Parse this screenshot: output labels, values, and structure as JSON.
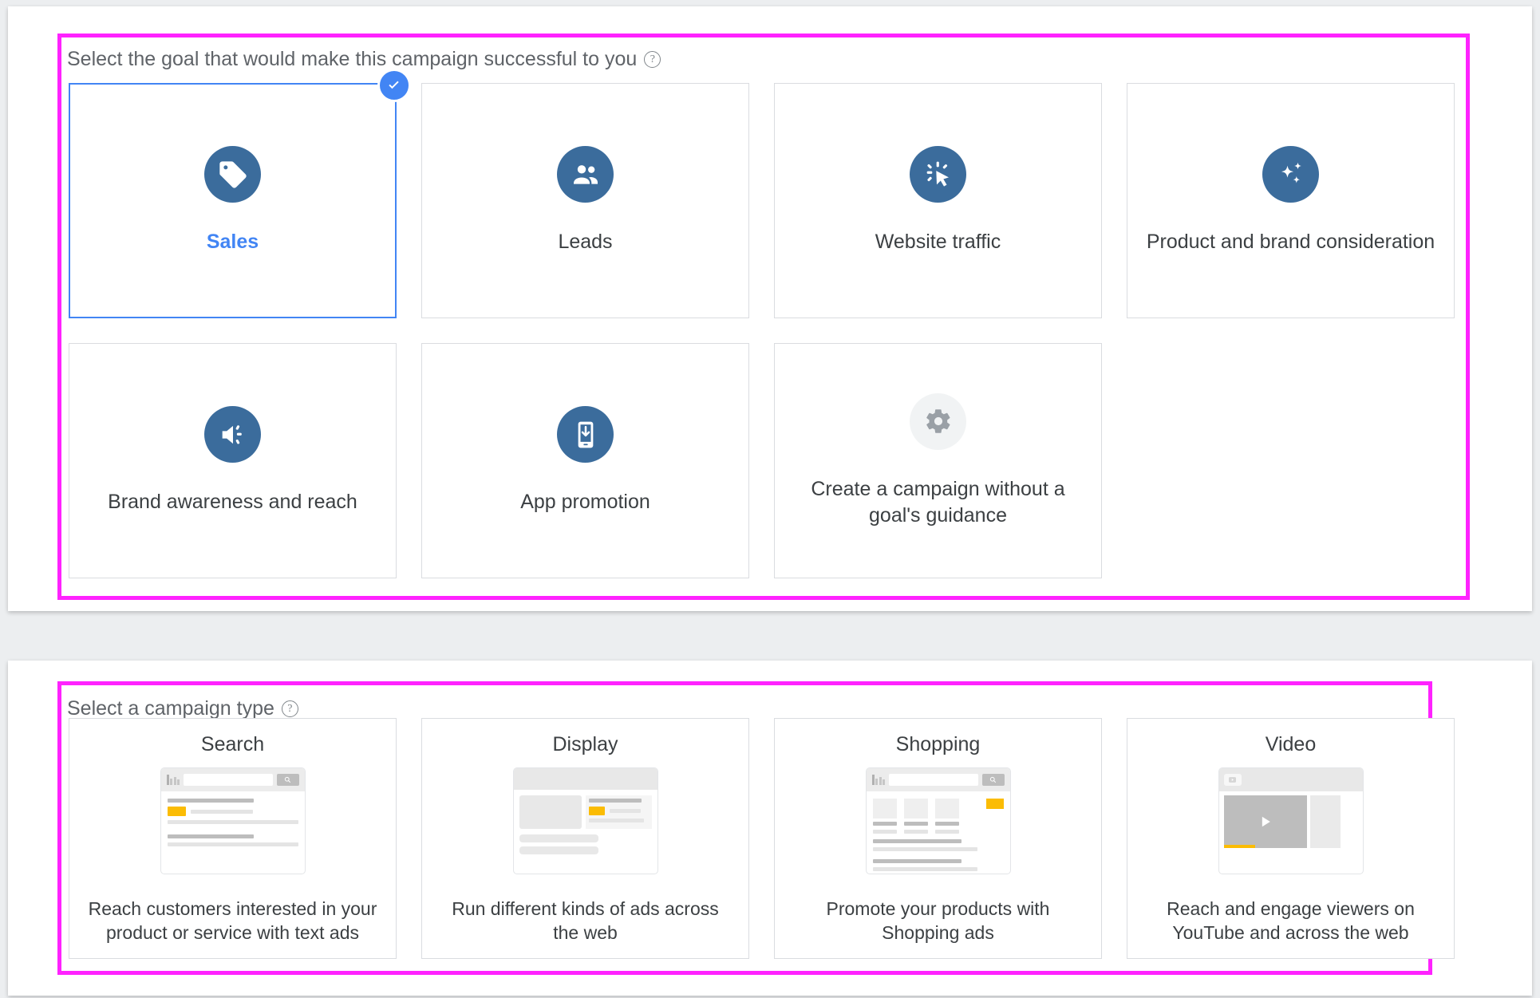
{
  "goals_section": {
    "header": "Select the goal that would make this campaign successful to you",
    "help_icon": "help-circle-icon",
    "cards": [
      {
        "label": "Sales",
        "icon": "price-tag-icon",
        "selected": true
      },
      {
        "label": "Leads",
        "icon": "people-group-icon",
        "selected": false
      },
      {
        "label": "Website traffic",
        "icon": "cursor-click-icon",
        "selected": false
      },
      {
        "label": "Product and brand consideration",
        "icon": "sparkles-icon",
        "selected": false
      },
      {
        "label": "Brand awareness and reach",
        "icon": "speaker-volume-icon",
        "selected": false
      },
      {
        "label": "App promotion",
        "icon": "mobile-download-icon",
        "selected": false
      },
      {
        "label": "Create a campaign without a goal's guidance",
        "icon": "gear-icon",
        "selected": false
      }
    ]
  },
  "types_section": {
    "header": "Select a campaign type",
    "help_icon": "help-circle-icon",
    "cards": [
      {
        "title": "Search",
        "description": "Reach customers interested in your product or service with text ads",
        "thumb": "search-results-thumbnail"
      },
      {
        "title": "Display",
        "description": "Run different kinds of ads across the web",
        "thumb": "display-banner-thumbnail"
      },
      {
        "title": "Shopping",
        "description": "Promote your products with Shopping ads",
        "thumb": "shopping-results-thumbnail"
      },
      {
        "title": "Video",
        "description": "Reach and engage viewers on YouTube and across the web",
        "thumb": "video-player-thumbnail"
      }
    ]
  },
  "colors": {
    "icon_blue": "#3b6c9c",
    "selected_blue": "#4285f4",
    "highlight_magenta": "#ff22ff",
    "ad_yellow": "#fbbc04",
    "text_primary": "#3c4043",
    "text_secondary": "#5f6368",
    "card_border": "#dadce0"
  }
}
